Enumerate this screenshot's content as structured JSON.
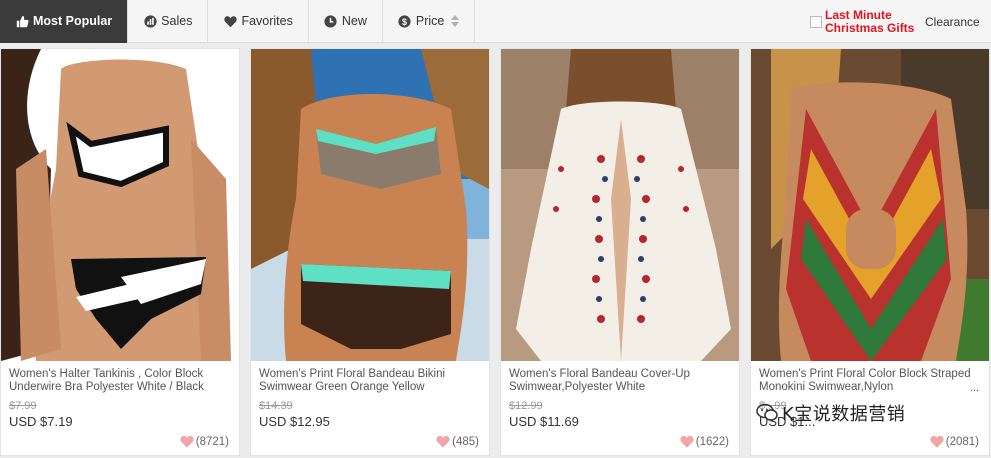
{
  "sort_bar": {
    "tabs": [
      {
        "label": "Most Popular",
        "icon": "thumbs-up-icon",
        "active": true
      },
      {
        "label": "Sales",
        "icon": "bar-chart-icon",
        "active": false
      },
      {
        "label": "Favorites",
        "icon": "heart-icon",
        "active": false
      },
      {
        "label": "New",
        "icon": "clock-icon",
        "active": false
      },
      {
        "label": "Price",
        "icon": "dollar-icon",
        "active": false
      }
    ],
    "promo_line1": "Last Minute",
    "promo_line2": "Christmas Gifts",
    "clearance_label": "Clearance"
  },
  "products": [
    {
      "title": "Women's Halter Tankinis , Color Block Underwire Bra Polyester White / Black",
      "more": "",
      "original_price": "$7.99",
      "price": "USD $7.19",
      "likes": "(8721)"
    },
    {
      "title": "Women's Print Floral Bandeau Bikini Swimwear Green Orange Yellow",
      "more": "",
      "original_price": "$14.39",
      "price": "USD $12.95",
      "likes": "(485)"
    },
    {
      "title": "Women's Floral Bandeau Cover-Up Swimwear,Polyester White",
      "more": "",
      "original_price": "$12.99",
      "price": "USD $11.69",
      "likes": "(1622)"
    },
    {
      "title": "Women's Print Floral Color Block Straped Monokini Swimwear,Nylon",
      "more": "...",
      "original_price": "$...99",
      "price": "USD $1...",
      "likes": "(2081)"
    }
  ],
  "watermark_text": "K宝说数据营销",
  "colors": {
    "accent_red": "#e0141e",
    "active_tab": "#3b3b3b",
    "heart": "#f2a5a5"
  }
}
